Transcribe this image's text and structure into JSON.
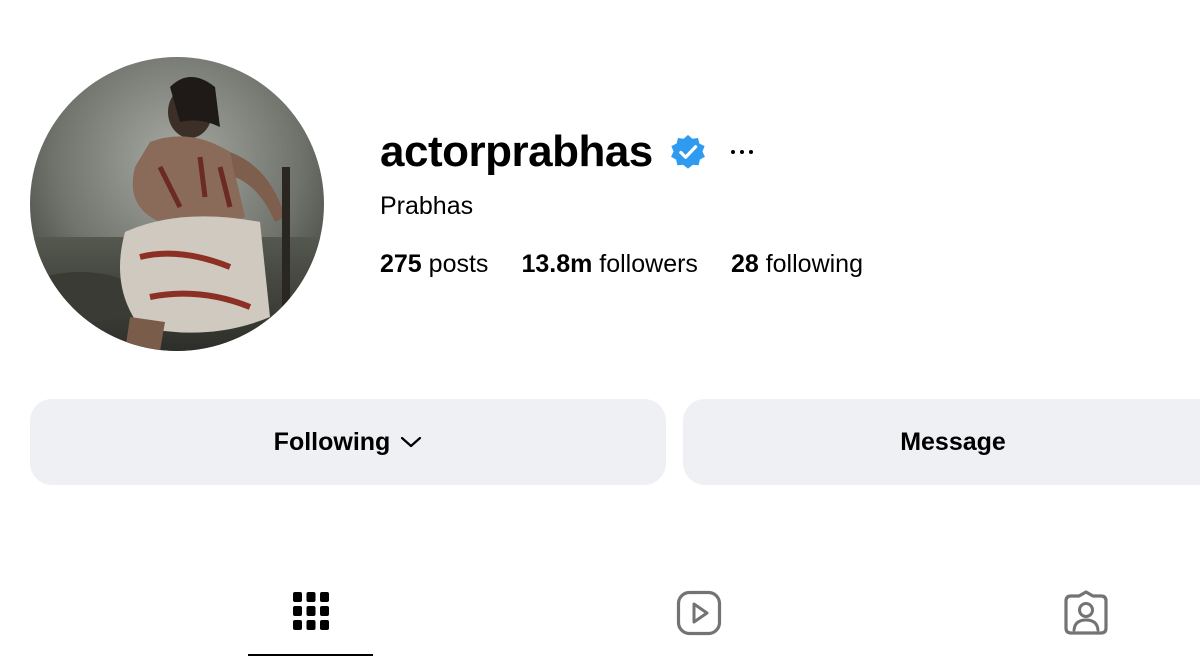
{
  "profile": {
    "username": "actorprabhas",
    "display_name": "Prabhas",
    "verified": true,
    "avatar_icon": "profile-photo",
    "stats": [
      {
        "value": "275",
        "label": "posts"
      },
      {
        "value": "13.8m",
        "label": "followers"
      },
      {
        "value": "28",
        "label": "following"
      }
    ]
  },
  "actions": {
    "following_label": "Following",
    "message_label": "Message"
  },
  "tabs": [
    {
      "icon": "grid-icon",
      "active": true
    },
    {
      "icon": "reels-icon",
      "active": false
    },
    {
      "icon": "tagged-icon",
      "active": false
    }
  ],
  "colors": {
    "verified_blue": "#2E9BF0",
    "button_bg": "#EFF0F4",
    "inactive_icon": "#737373"
  }
}
